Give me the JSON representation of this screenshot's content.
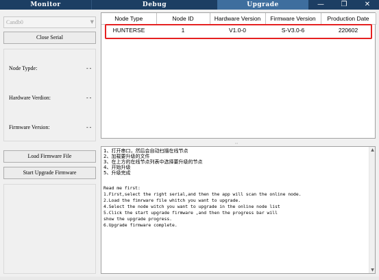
{
  "tabs": {
    "monitor": "Monitor",
    "debug": "Debug",
    "upgrade": "Upgrade"
  },
  "window_controls": {
    "minimize": "—",
    "restore": "❐",
    "close": "✕"
  },
  "left_panel": {
    "port_select": "Candb0",
    "close_serial_label": "Close Serial",
    "node_type_label": "Node Typde:",
    "node_type_value": "- -",
    "hardware_version_label": "Hardware Verdion:",
    "hardware_version_value": "- -",
    "firmware_version_label": "Firmware Version:",
    "firmware_version_value": "- -",
    "load_firmware_label": "Load Firmware File",
    "start_upgrade_label": "Start Upgrade Firmware"
  },
  "node_table": {
    "columns": [
      "Node Type",
      "Node ID",
      "Hardware Version",
      "Firmware Version",
      "Production Date"
    ],
    "rows": [
      [
        "HUNTERSE",
        "1",
        "V1.0-0",
        "S-V3.0-6",
        "220602"
      ]
    ]
  },
  "instructions": {
    "lines": [
      "1、打开串口，然后会自动扫描在线节点",
      "2、加载要升级的文件",
      "3、在上方的在线节点列表中选择要升级的节点",
      "4、开始升级",
      "5、升级完成",
      "",
      "Read me first:",
      "1.First,select the right serial,and then the app will scan the online node.",
      "2.Load the fimrware file whitch you want to upgrade.",
      "4.Select the node witch you want to upgrade in the online node list",
      "5.Click the start upgrade firmware ,and then the progress bar will",
      "show the upgrade progress.",
      "6.Upgrade firmware complete."
    ]
  },
  "colors": {
    "titlebar": "#1c3e63",
    "active_tab": "#3e6e9e",
    "highlight_frame": "#e52020"
  }
}
